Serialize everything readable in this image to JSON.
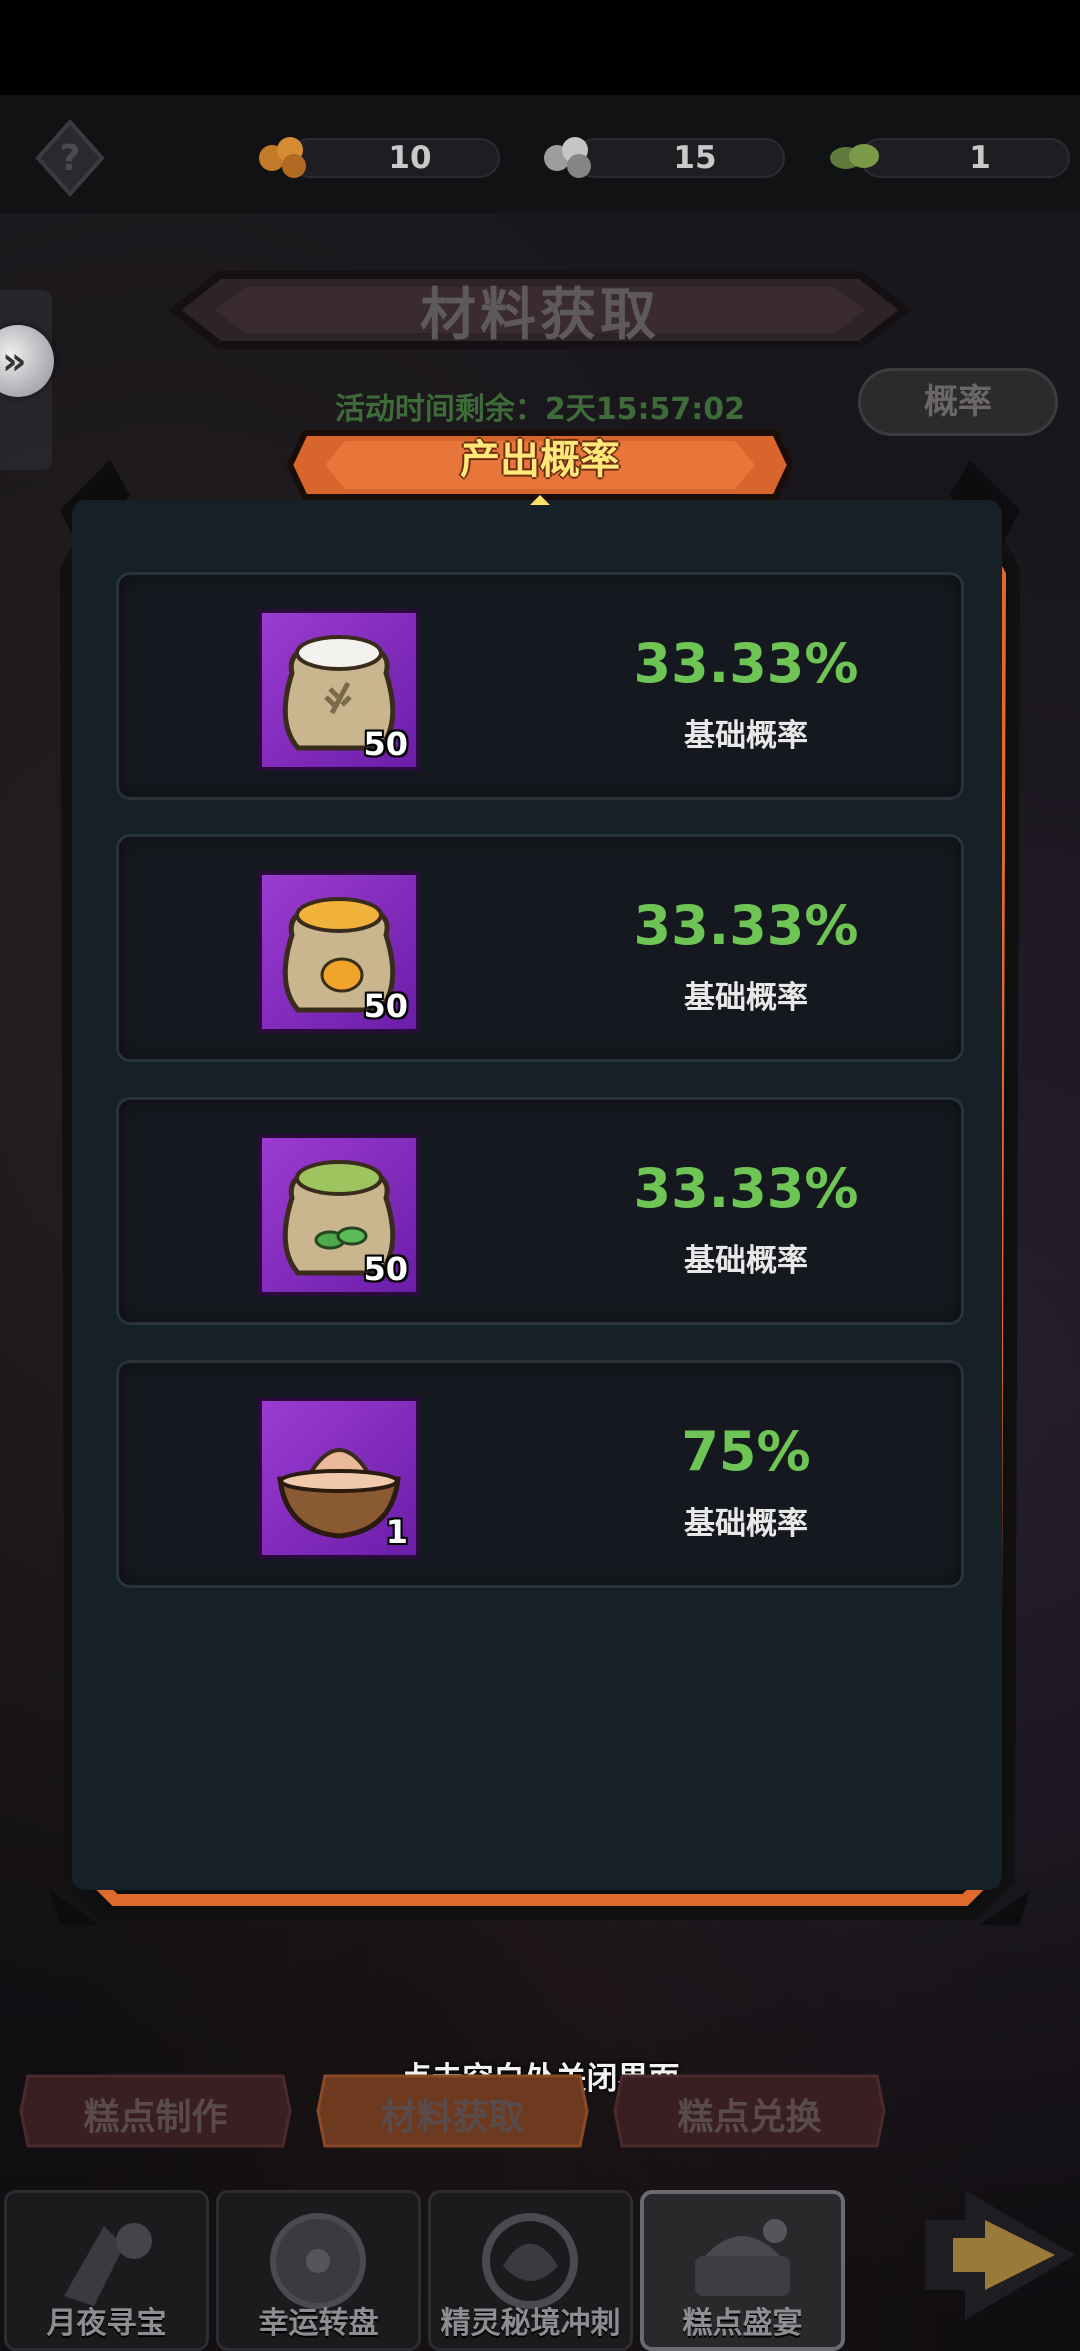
{
  "currencies": [
    {
      "icon": "orange-flour-icon",
      "value": "10"
    },
    {
      "icon": "white-flour-icon",
      "value": "15"
    },
    {
      "icon": "green-leaf-icon",
      "value": "1"
    }
  ],
  "header": {
    "title": "材料获取",
    "timer": "活动时间剩余：2天15:57:02",
    "rate_button": "概率"
  },
  "panel": {
    "title": "产出概率",
    "rows": [
      {
        "icon": "white-flour-sack-icon",
        "qty": "50",
        "percent": "33.33%",
        "label": "基础概率"
      },
      {
        "icon": "orange-flour-sack-icon",
        "qty": "50",
        "percent": "33.33%",
        "label": "基础概率"
      },
      {
        "icon": "green-flour-sack-icon",
        "qty": "50",
        "percent": "33.33%",
        "label": "基础概率"
      },
      {
        "icon": "flour-bowl-icon",
        "qty": "1",
        "percent": "75%",
        "label": "基础概率"
      }
    ]
  },
  "close_hint": "点击空白处关闭界面",
  "subtabs": [
    "糕点制作",
    "材料获取",
    "糕点兑换"
  ],
  "nav": [
    {
      "label": "月夜寻宝",
      "icon": "moon-treasure-icon"
    },
    {
      "label": "幸运转盘",
      "icon": "lucky-wheel-icon"
    },
    {
      "label": "精灵秘境冲刺",
      "icon": "spirit-realm-icon"
    },
    {
      "label": "糕点盛宴",
      "icon": "pastry-feast-icon"
    }
  ],
  "colors": {
    "accent_orange": "#e06a2c",
    "percent_green": "#6ec454",
    "panel_bg": "#162027",
    "item_purple": "#8a2fc4"
  }
}
